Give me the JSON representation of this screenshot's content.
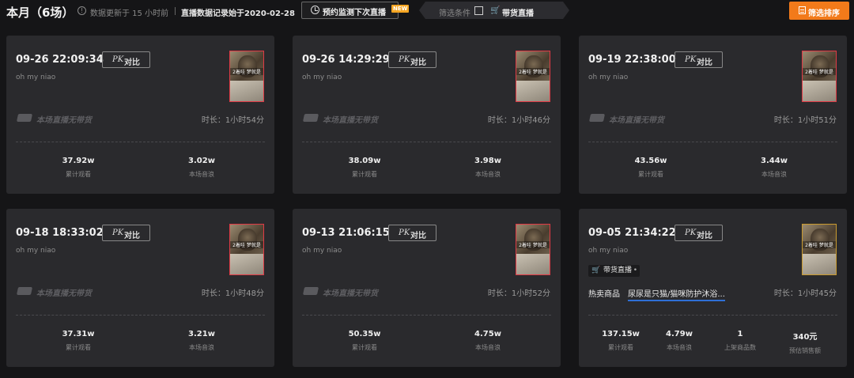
{
  "header": {
    "title": "本月（6场）",
    "update_text": "数据更新于 15 小时前",
    "record_text": "直播数据记录始于2020-02-28",
    "monitor_button": "预约监测下次直播",
    "new_badge": "NEW",
    "filter_label": "筛选条件",
    "filter_option": "带货直播",
    "sort_button": "筛选排序"
  },
  "common": {
    "pk_prefix": "PK",
    "pk_label": "对比",
    "no_goods_label": "本场直播无带货",
    "views_label": "累计观看",
    "sound_label": "本场音浪",
    "products_label": "上架商品数",
    "sales_label": "预估销售额",
    "thumb_caption": "2着哇 梦就是"
  },
  "cards": [
    {
      "time": "09-26 22:09:34",
      "user": "oh my niao",
      "duration": "时长：1小时54分",
      "views": "37.92w",
      "sound": "3.02w"
    },
    {
      "time": "09-26 14:29:29",
      "user": "oh my niao",
      "duration": "时长：1小时46分",
      "views": "38.09w",
      "sound": "3.98w"
    },
    {
      "time": "09-19 22:38:00",
      "user": "oh my niao",
      "duration": "时长：1小时51分",
      "views": "43.56w",
      "sound": "3.44w"
    },
    {
      "time": "09-18 18:33:02",
      "user": "oh my niao",
      "duration": "时长：1小时48分",
      "views": "37.31w",
      "sound": "3.21w"
    },
    {
      "time": "09-13 21:06:15",
      "user": "oh my niao",
      "duration": "时长：1小时52分",
      "views": "50.35w",
      "sound": "4.75w"
    },
    {
      "time": "09-05 21:34:22",
      "user": "oh my niao",
      "duration": "时长：1小时45分",
      "views": "137.15w",
      "sound": "4.79w",
      "goods_tag": "带货直播",
      "hot_label": "热卖商品",
      "hot_item": "尿尿是只猫/猫咪防护沐浴...",
      "products": "1",
      "sales": "340元"
    }
  ]
}
